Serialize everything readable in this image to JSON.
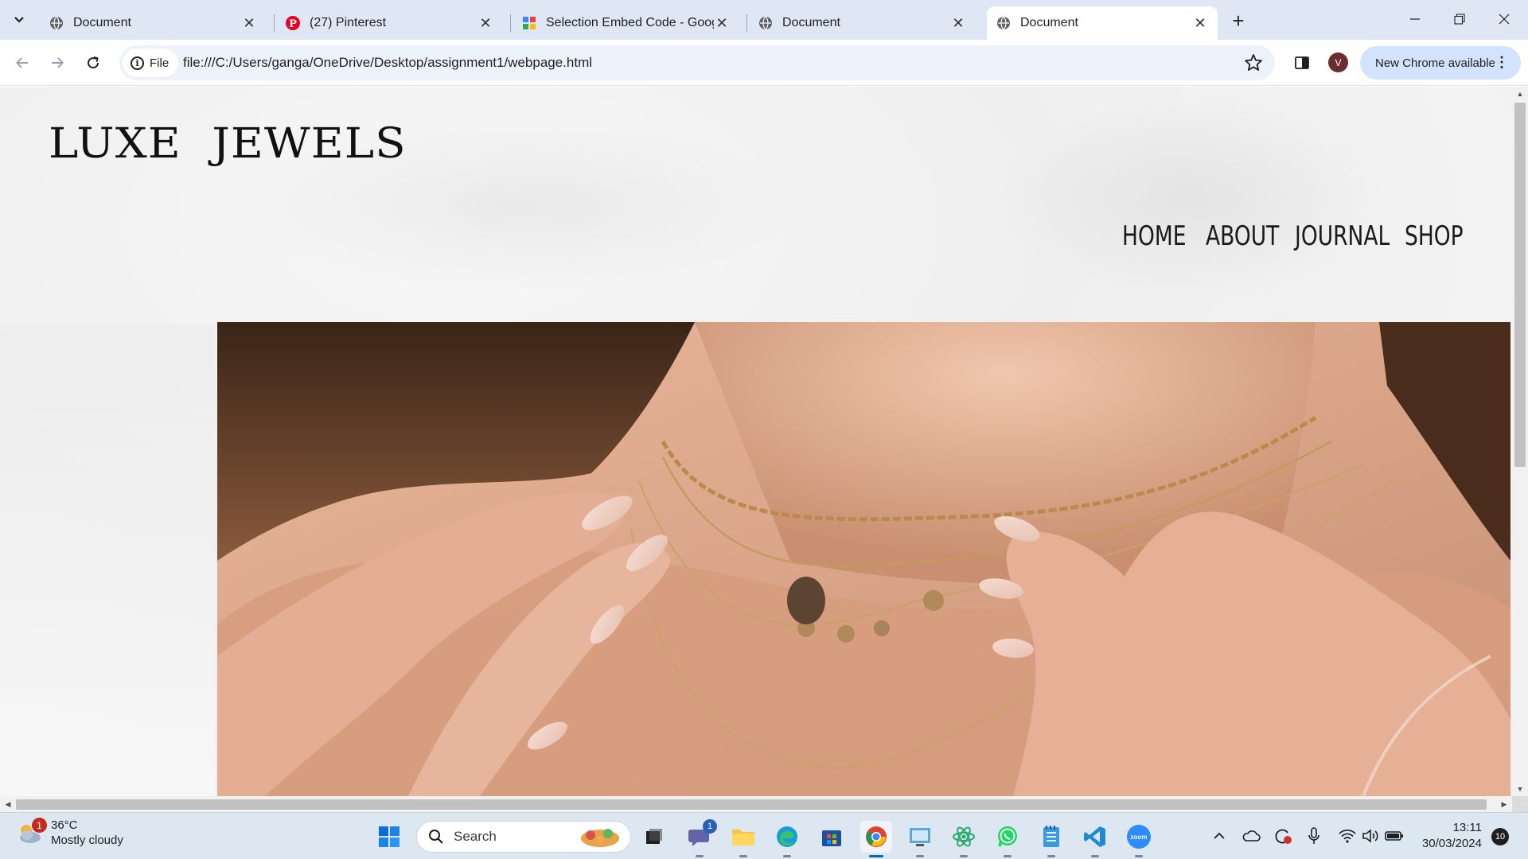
{
  "browser": {
    "tabs": [
      {
        "title": "Document",
        "icon": "globe-icon",
        "active": false
      },
      {
        "title": "(27) Pinterest",
        "icon": "pinterest-icon",
        "active": false
      },
      {
        "title": "Selection Embed Code - Google",
        "icon": "google-sites-icon",
        "active": false
      },
      {
        "title": "Document",
        "icon": "globe-icon",
        "active": false
      },
      {
        "title": "Document",
        "icon": "globe-icon",
        "active": true
      }
    ],
    "site_chip_label": "File",
    "url": "file:///C:/Users/ganga/OneDrive/Desktop/assignment1/webpage.html",
    "profile_initial": "V",
    "update_label": "New Chrome available"
  },
  "page": {
    "brand": "LUXE  JEWELS",
    "nav": [
      "HOME",
      "ABOUT",
      "JOURNAL",
      "SHOP"
    ],
    "hero_image": "woman-with-gold-layered-necklaces"
  },
  "taskbar": {
    "weather_temp": "36°C",
    "weather_desc": "Mostly cloudy",
    "weather_badge": "1",
    "search_placeholder": "Search",
    "teams_badge": "1",
    "time": "13:11",
    "date": "30/03/2024",
    "notifications": "10"
  },
  "colors": {
    "tabstrip": "#dfe7f5",
    "omnibox": "#edf2fa",
    "update_chip": "#d3e3fd",
    "taskbar": "#dde7f1",
    "accent": "#0067c0"
  }
}
